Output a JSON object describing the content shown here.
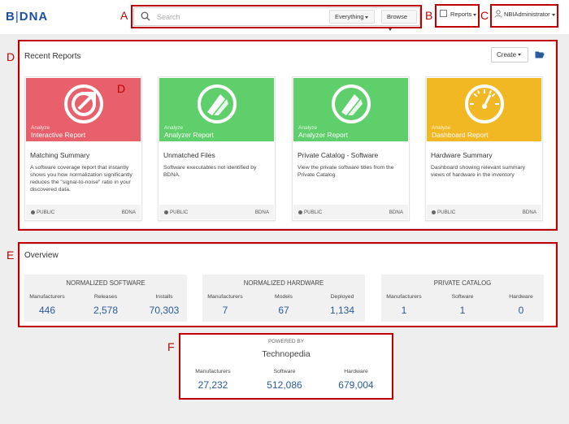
{
  "header": {
    "logo": {
      "b": "B",
      "mid": "|",
      "rest": "DNA"
    },
    "search_placeholder": "Search",
    "everything_label": "Everything",
    "browse_label": "Browse",
    "reports_label": "Reports",
    "user_label": "NBIAdministrator"
  },
  "annotations": {
    "A": "A",
    "B": "B",
    "C": "C",
    "D": "D",
    "D2": "D",
    "E": "E",
    "F": "F"
  },
  "recent_reports": {
    "title": "Recent Reports",
    "create_label": "Create",
    "cards": [
      {
        "kicker": "Analyze",
        "type": "Interactive Report",
        "title": "Matching Summary",
        "desc": "A software coverage report that instantly shows you how normalization significantly reduces the \"signal-to-noise\" ratio in your discovered data.",
        "visibility": "PUBLIC",
        "vendor": "BDNA",
        "color": "#e8606b",
        "icon": "arrow-out-icon"
      },
      {
        "kicker": "Analyze",
        "type": "Analyzer Report",
        "title": "Unmatched Files",
        "desc": "Software executables not identified by BDNA.",
        "visibility": "PUBLIC",
        "vendor": "BDNA",
        "color": "#5ecf6a",
        "icon": "analyzer-icon"
      },
      {
        "kicker": "Analyze",
        "type": "Analyzer Report",
        "title": "Private Catalog - Software",
        "desc": "View the private software titles from the Private Catalog",
        "visibility": "PUBLIC",
        "vendor": "BDNA",
        "color": "#5ecf6a",
        "icon": "analyzer-icon"
      },
      {
        "kicker": "Analyze",
        "type": "Dashboard Report",
        "title": "Hardware Summary",
        "desc": "Dashboard showing relevant summary views of hardware in the inventory",
        "visibility": "PUBLIC",
        "vendor": "BDNA",
        "color": "#f2b824",
        "icon": "gauge-icon"
      }
    ]
  },
  "overview": {
    "title": "Overview",
    "groups": [
      {
        "heading": "NORMALIZED SOFTWARE",
        "stats": [
          {
            "label": "Manufacturers",
            "value": "446"
          },
          {
            "label": "Releases",
            "value": "2,578"
          },
          {
            "label": "Installs",
            "value": "70,303"
          }
        ]
      },
      {
        "heading": "NORMALIZED HARDWARE",
        "stats": [
          {
            "label": "Manufacturers",
            "value": "7"
          },
          {
            "label": "Models",
            "value": "67"
          },
          {
            "label": "Deployed",
            "value": "1,134"
          }
        ]
      },
      {
        "heading": "PRIVATE CATALOG",
        "stats": [
          {
            "label": "Manufacturers",
            "value": "1"
          },
          {
            "label": "Software",
            "value": "1"
          },
          {
            "label": "Hardware",
            "value": "0"
          }
        ]
      }
    ]
  },
  "technopedia": {
    "powered_by": "POWERED BY",
    "name": "Technopedia",
    "stats": [
      {
        "label": "Manufacturers",
        "value": "27,232"
      },
      {
        "label": "Software",
        "value": "512,086"
      },
      {
        "label": "Hardware",
        "value": "679,004"
      }
    ]
  }
}
